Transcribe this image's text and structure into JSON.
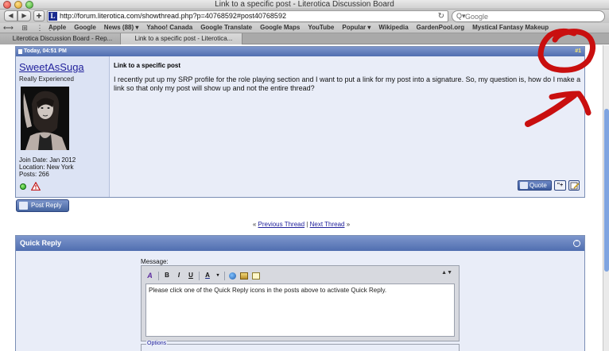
{
  "window": {
    "title": "Link to a specific post - Literotica Discussion Board"
  },
  "toolbar": {
    "back": "◀",
    "forward": "▶",
    "add": "+",
    "site_icon_letter": "L",
    "url": "http://forum.literotica.com/showthread.php?p=40768592#post40768592",
    "reload": "↻",
    "search_icon": "Q▾",
    "search_placeholder": "Google"
  },
  "bookmarks": {
    "icons": "⟷ ⊞ ⋮⋮",
    "items": [
      "Apple",
      "Google",
      "News (88) ▾",
      "Yahoo! Canada",
      "Google Translate",
      "Google Maps",
      "YouTube",
      "Popular ▾",
      "Wikipedia",
      "GardenPool.org",
      "Mystical Fantasy Makeup"
    ]
  },
  "tabs": [
    {
      "label": "Literotica Discussion Board - Rep..."
    },
    {
      "label": "Link to a specific post - Literotica..."
    }
  ],
  "post": {
    "date": "Today, 04:51 PM",
    "number": "#1",
    "username": "SweetAsSuga",
    "user_title": "Really Experienced",
    "join_date": "Join Date: Jan 2012",
    "location": "Location: New York",
    "posts": "Posts: 266",
    "title": "Link to a specific post",
    "body": "I recently put up my SRP profile for the role playing section and I want to put a link for my post into a signature. So, my question is, how do I make a link so that only my post will show up and not the entire thread?",
    "quote_label": "Quote",
    "multiquote_label": "\"+"
  },
  "post_reply_label": "Post Reply",
  "thread_nav": {
    "left_marker": "«",
    "previous": "Previous Thread",
    "separator": "|",
    "next": "Next Thread",
    "right_marker": "»"
  },
  "quick_reply": {
    "title": "Quick Reply",
    "collapse": "⌃",
    "message_label": "Message:",
    "toolbar": {
      "bold": "B",
      "italic": "I",
      "underline": "U",
      "color": "A",
      "color_arrow": "▾",
      "format": "A"
    },
    "resize": "▲▼",
    "placeholder": "Please click one of the Quick Reply icons in the posts above to activate Quick Reply.",
    "options_label": "Options"
  },
  "colors": {
    "annotation": "#c90f0f",
    "header_blue": "#506eb0",
    "link": "#22229c"
  }
}
